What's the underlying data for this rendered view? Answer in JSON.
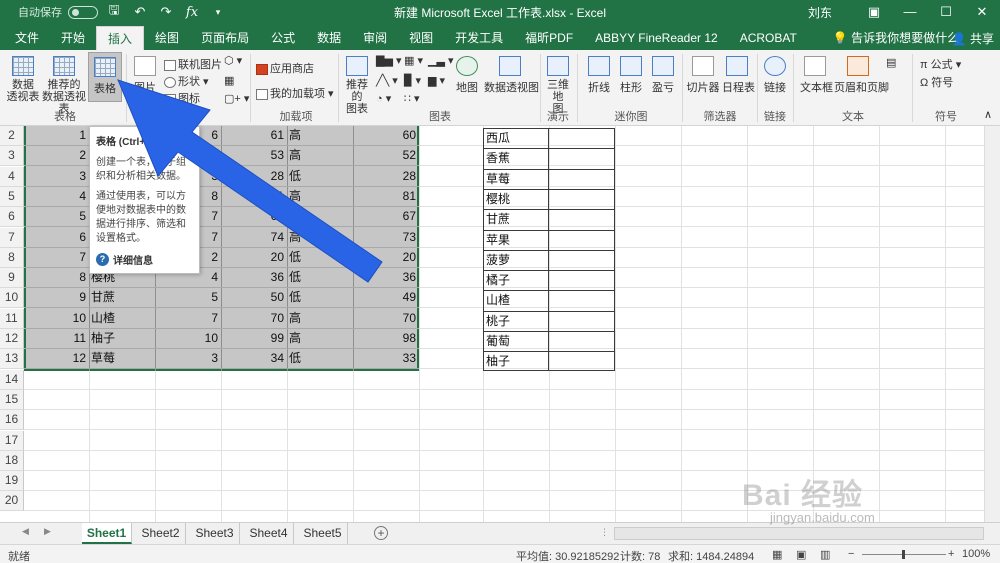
{
  "titlebar": {
    "autosave_label": "自动保存",
    "autosave_state": "关",
    "window_title": "新建 Microsoft Excel 工作表.xlsx - Excel",
    "user": "刘东",
    "qat_icons": [
      "save-icon",
      "undo-icon",
      "redo-icon",
      "function-icon"
    ]
  },
  "tabs": [
    "文件",
    "开始",
    "插入",
    "绘图",
    "页面布局",
    "公式",
    "数据",
    "审阅",
    "视图",
    "开发工具",
    "福昕PDF",
    "ABBYY FineReader 12",
    "ACROBAT"
  ],
  "active_tab": "插入",
  "tell_me": "告诉我你想要做什么",
  "share": "共享",
  "ribbon": {
    "pivot_table": "数据\n透视表",
    "recommended_pivot": "推荐的\n数据透视表",
    "table": "表格",
    "picture": "图片",
    "online_picture": "联机图片",
    "shapes": "形状",
    "icons": "图标",
    "store": "应用商店",
    "my_addins": "我的加载项",
    "recommended_charts": "推荐的\n图表",
    "maps": "地图",
    "pivot_chart": "数据透视图",
    "3d_map": "三维地\n图",
    "line": "折线",
    "column": "柱形",
    "win_loss": "盈亏",
    "slicer": "切片器",
    "timeline": "日程表",
    "link": "链接",
    "textbox": "文本框",
    "header_footer": "页眉和页脚",
    "equation": "公式",
    "symbol": "符号",
    "groups": [
      "表格",
      "插图",
      "加载项",
      "图表",
      "演示",
      "迷你图",
      "筛选器",
      "链接",
      "文本",
      "符号"
    ]
  },
  "tooltip": {
    "title": "表格 (Ctrl+T)",
    "para1": "创建一个表，用于组织和分析相关数据。",
    "para2": "通过使用表，可以方便地对数据表中的数据进行排序、筛选和设置格式。",
    "more": "详细信息"
  },
  "row_numbers": [
    2,
    3,
    4,
    5,
    6,
    7,
    8,
    9,
    10,
    11,
    12,
    13,
    14,
    15,
    16,
    17,
    18,
    19,
    20
  ],
  "table_rows": [
    {
      "a": "1",
      "b": "",
      "c": "6",
      "d": "61",
      "e": "高",
      "f": "60"
    },
    {
      "a": "2",
      "b": "",
      "c": "5",
      "d": "53",
      "e": "高",
      "f": "52"
    },
    {
      "a": "3",
      "b": "",
      "c": "3",
      "d": "28",
      "e": "低",
      "f": "28"
    },
    {
      "a": "4",
      "b": "",
      "c": "8",
      "d": "81",
      "e": "高",
      "f": "81"
    },
    {
      "a": "5",
      "b": "",
      "c": "7",
      "d": "67",
      "e": "高",
      "f": "67"
    },
    {
      "a": "6",
      "b": "",
      "c": "7",
      "d": "74",
      "e": "高",
      "f": "73"
    },
    {
      "a": "7",
      "b": "",
      "c": "2",
      "d": "20",
      "e": "低",
      "f": "20"
    },
    {
      "a": "8",
      "b": "樱桃",
      "c": "4",
      "d": "36",
      "e": "低",
      "f": "36"
    },
    {
      "a": "9",
      "b": "甘蔗",
      "c": "5",
      "d": "50",
      "e": "低",
      "f": "49"
    },
    {
      "a": "10",
      "b": "山楂",
      "c": "7",
      "d": "70",
      "e": "高",
      "f": "70"
    },
    {
      "a": "11",
      "b": "柚子",
      "c": "10",
      "d": "99",
      "e": "高",
      "f": "98"
    },
    {
      "a": "12",
      "b": "草莓",
      "c": "3",
      "d": "34",
      "e": "低",
      "f": "33"
    }
  ],
  "fruit_list": [
    "西瓜",
    "香蕉",
    "草莓",
    "樱桃",
    "甘蔗",
    "苹果",
    "菠萝",
    "橘子",
    "山楂",
    "桃子",
    "葡萄",
    "柚子"
  ],
  "sheets": [
    "Sheet1",
    "Sheet2",
    "Sheet3",
    "Sheet4",
    "Sheet5"
  ],
  "active_sheet": "Sheet1",
  "status": {
    "mode": "就绪",
    "average": "平均值: 30.92185292",
    "count": "计数: 78",
    "sum": "求和: 1484.24894",
    "zoom": "100%"
  },
  "watermark": {
    "main": "Bai 经验",
    "sub": "jingyan.baidu.com"
  },
  "colors": {
    "excel_green": "#217346",
    "selection_gray": "#c6c6c6",
    "arrow_blue": "#2a64e6"
  }
}
